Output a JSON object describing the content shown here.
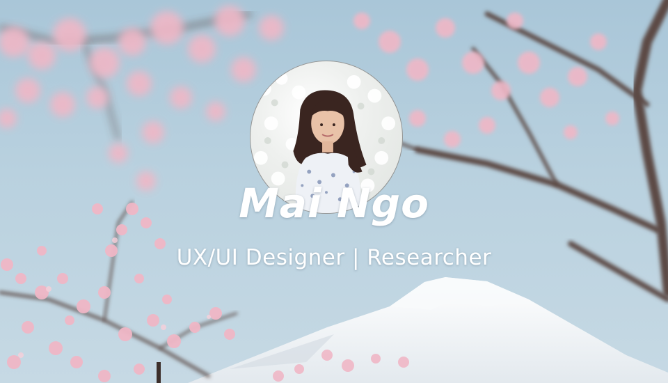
{
  "profile": {
    "name": "Mai Ngo",
    "role": "UX/UI Designer | Researcher"
  },
  "background": {
    "scene": "cherry-blossoms-and-mountain",
    "sky_color": "#b4cddc",
    "blossom_color": "#f0b7c6",
    "branch_color": "#5c4a44",
    "mountain_color": "#f4f6f8"
  },
  "avatar": {
    "icon": "profile-photo",
    "hair_color": "#3a2520",
    "skin_color": "#e9c2a8"
  }
}
